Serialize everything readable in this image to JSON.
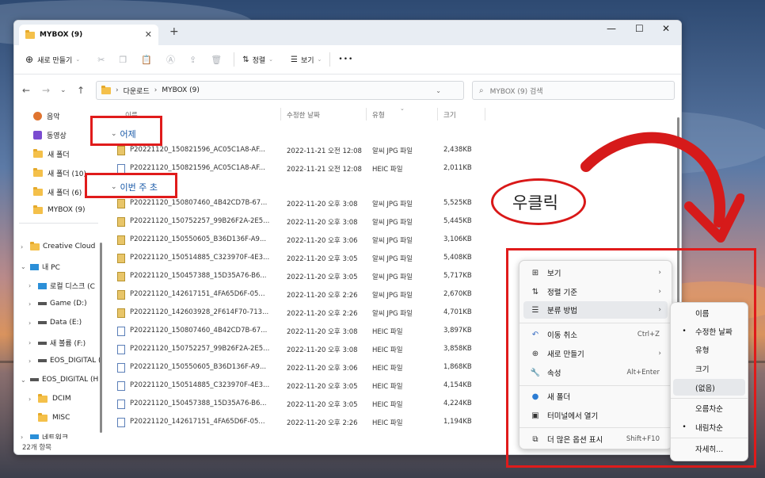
{
  "window": {
    "tab_title": "MYBOX (9)",
    "close_glyph": "✕",
    "new_tab_glyph": "+",
    "minimize_glyph": "—",
    "maximize_glyph": "☐",
    "window_close_glyph": "✕"
  },
  "toolbar": {
    "new_label": "새로 만들기",
    "sort_label": "정렬",
    "view_label": "보기",
    "more_glyph": "•••"
  },
  "address": {
    "path_sep": "›",
    "crumb1": "다운로드",
    "crumb2": "MYBOX (9)",
    "search_placeholder": "MYBOX (9) 검색"
  },
  "sidebar": {
    "items": [
      {
        "label": "음악"
      },
      {
        "label": "동영상"
      },
      {
        "label": "새 폴더"
      },
      {
        "label": "새 폴더 (10)"
      },
      {
        "label": "새 폴더 (6)"
      },
      {
        "label": "MYBOX (9)"
      },
      {
        "label": "Creative Cloud"
      },
      {
        "label": "내 PC"
      },
      {
        "label": "로컬 디스크 (C"
      },
      {
        "label": "Game (D:)"
      },
      {
        "label": "Data (E:)"
      },
      {
        "label": "새 볼륨 (F:)"
      },
      {
        "label": "EOS_DIGITAL ("
      },
      {
        "label": "EOS_DIGITAL (H"
      },
      {
        "label": "DCIM"
      },
      {
        "label": "MISC"
      },
      {
        "label": "네트워크"
      }
    ]
  },
  "columns": {
    "name": "이름",
    "date": "수정한 날짜",
    "type": "유형",
    "size": "크기"
  },
  "groups": {
    "yesterday": "어제",
    "this_week": "이번 주 초"
  },
  "files_yesterday": [
    {
      "name": "P20221120_150821596_AC05C1A8-AF...",
      "date": "2022-11-21 오전 12:08",
      "type": "알씨 JPG 파일",
      "size": "2,438KB"
    },
    {
      "name": "P20221120_150821596_AC05C1A8-AF...",
      "date": "2022-11-21 오전 12:08",
      "type": "HEIC 파일",
      "size": "2,011KB"
    }
  ],
  "files_week": [
    {
      "name": "P20221120_150807460_4B42CD7B-67...",
      "date": "2022-11-20 오후 3:08",
      "type": "알씨 JPG 파일",
      "size": "5,525KB"
    },
    {
      "name": "P20221120_150752257_99B26F2A-2E5...",
      "date": "2022-11-20 오후 3:08",
      "type": "알씨 JPG 파일",
      "size": "5,445KB"
    },
    {
      "name": "P20221120_150550605_B36D136F-A9...",
      "date": "2022-11-20 오후 3:06",
      "type": "알씨 JPG 파일",
      "size": "3,106KB"
    },
    {
      "name": "P20221120_150514885_C323970F-4E3...",
      "date": "2022-11-20 오후 3:05",
      "type": "알씨 JPG 파일",
      "size": "5,408KB"
    },
    {
      "name": "P20221120_150457388_15D35A76-B6...",
      "date": "2022-11-20 오후 3:05",
      "type": "알씨 JPG 파일",
      "size": "5,717KB"
    },
    {
      "name": "P20221120_142617151_4FA65D6F-05...",
      "date": "2022-11-20 오후 2:26",
      "type": "알씨 JPG 파일",
      "size": "2,670KB"
    },
    {
      "name": "P20221120_142603928_2F614F70-713...",
      "date": "2022-11-20 오후 2:26",
      "type": "알씨 JPG 파일",
      "size": "4,701KB"
    },
    {
      "name": "P20221120_150807460_4B42CD7B-67...",
      "date": "2022-11-20 오후 3:08",
      "type": "HEIC 파일",
      "size": "3,897KB"
    },
    {
      "name": "P20221120_150752257_99B26F2A-2E5...",
      "date": "2022-11-20 오후 3:08",
      "type": "HEIC 파일",
      "size": "3,858KB"
    },
    {
      "name": "P20221120_150550605_B36D136F-A9...",
      "date": "2022-11-20 오후 3:06",
      "type": "HEIC 파일",
      "size": "1,868KB"
    },
    {
      "name": "P20221120_150514885_C323970F-4E3...",
      "date": "2022-11-20 오후 3:05",
      "type": "HEIC 파일",
      "size": "4,154KB"
    },
    {
      "name": "P20221120_150457388_15D35A76-B6...",
      "date": "2022-11-20 오후 3:05",
      "type": "HEIC 파일",
      "size": "4,224KB"
    },
    {
      "name": "P20221120_142617151_4FA65D6F-05...",
      "date": "2022-11-20 오후 2:26",
      "type": "HEIC 파일",
      "size": "1,194KB"
    }
  ],
  "status": {
    "count": "22개 항목"
  },
  "annotation": {
    "right_click": "우클릭"
  },
  "context_menu": {
    "view": "보기",
    "sort": "정렬 기준",
    "group": "분류 방법",
    "undo": "이동 취소",
    "undo_sc": "Ctrl+Z",
    "new": "새로 만들기",
    "properties": "속성",
    "properties_sc": "Alt+Enter",
    "new_folder": "새 폴더",
    "terminal": "터미널에서 열기",
    "more": "더 많은 옵션 표시",
    "more_sc": "Shift+F10"
  },
  "submenu": {
    "name": "이름",
    "date": "수정한 날짜",
    "type": "유형",
    "size": "크기",
    "none": "(없음)",
    "asc": "오름차순",
    "desc": "내림차순",
    "more": "자세히..."
  },
  "colors": {
    "accent_blue": "#1a5aa8",
    "annotation_red": "#e01b1b"
  }
}
